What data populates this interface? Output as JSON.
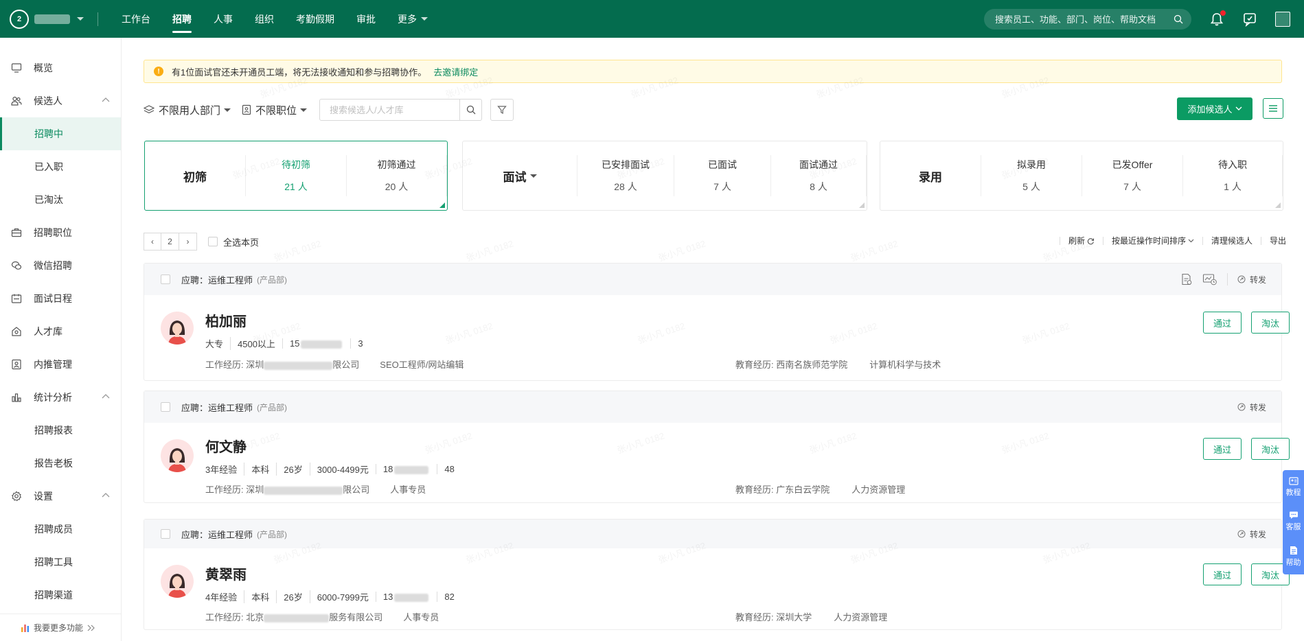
{
  "topbar": {
    "logo_text": "2",
    "nav": [
      "工作台",
      "招聘",
      "人事",
      "组织",
      "考勤假期",
      "审批",
      "更多"
    ],
    "active_nav": 1,
    "search_placeholder": "搜索员工、功能、部门、岗位、帮助文档"
  },
  "sidebar": {
    "items": [
      {
        "label": "概览",
        "icon": "monitor-icon"
      },
      {
        "label": "候选人",
        "icon": "people-icon"
      },
      {
        "label": "招聘中"
      },
      {
        "label": "已入职"
      },
      {
        "label": "已淘汰"
      },
      {
        "label": "招聘职位",
        "icon": "briefcase-icon"
      },
      {
        "label": "微信招聘",
        "icon": "wechat-icon"
      },
      {
        "label": "面试日程",
        "icon": "calendar-icon"
      },
      {
        "label": "人才库",
        "icon": "talent-icon"
      },
      {
        "label": "内推管理",
        "icon": "referral-icon"
      },
      {
        "label": "统计分析",
        "icon": "chart-icon"
      },
      {
        "label": "招聘报表"
      },
      {
        "label": "报告老板"
      },
      {
        "label": "设置",
        "icon": "gear-icon"
      },
      {
        "label": "招聘成员"
      },
      {
        "label": "招聘工具"
      },
      {
        "label": "招聘渠道"
      }
    ],
    "footer": "我要更多功能"
  },
  "notice": {
    "text": "有1位面试官还未开通员工端，将无法接收通知和参与招聘协作。",
    "link": "去邀请绑定"
  },
  "filters": {
    "dept": "不限用人部门",
    "position": "不限职位",
    "search_placeholder": "搜索候选人/人才库",
    "add_label": "添加候选人"
  },
  "stages": {
    "screen": {
      "title": "初筛",
      "cells": [
        {
          "label": "待初筛",
          "count": "21 人"
        },
        {
          "label": "初筛通过",
          "count": "20 人"
        }
      ]
    },
    "interview": {
      "title": "面试",
      "cells": [
        {
          "label": "已安排面试",
          "count": "28 人"
        },
        {
          "label": "已面试",
          "count": "7 人"
        },
        {
          "label": "面试通过",
          "count": "8 人"
        }
      ]
    },
    "hire": {
      "title": "录用",
      "cells": [
        {
          "label": "拟录用",
          "count": "5 人"
        },
        {
          "label": "已发Offer",
          "count": "7 人"
        },
        {
          "label": "待入职",
          "count": "1 人"
        }
      ]
    }
  },
  "pager": {
    "prev": "‹",
    "page": "2",
    "next": "›",
    "select_all": "全选本页"
  },
  "toolbar": {
    "refresh": "刷新",
    "sort": "按最近操作时间排序",
    "clean": "清理候选人",
    "export": "导出"
  },
  "candidate_labels": {
    "apply_prefix": "应聘：",
    "forward": "转发",
    "pass": "通过",
    "reject": "淘汰",
    "work_prefix": "工作经历:",
    "edu_prefix": "教育经历:"
  },
  "candidates": [
    {
      "position": "运维工程师",
      "dept": "(产品部)",
      "name": "柏加丽",
      "info": [
        "大专",
        "4500以上",
        "15"
      ],
      "phone_tail": "3",
      "work_company_start": "深圳",
      "work_company_end": "限公司",
      "work_role": "SEO工程师/网站编辑",
      "edu_school": "西南名族师范学院",
      "edu_major": "计算机科学与技术"
    },
    {
      "position": "运维工程师",
      "dept": "(产品部)",
      "name": "何文静",
      "info": [
        "3年经验",
        "本科",
        "26岁",
        "3000-4499元",
        "18"
      ],
      "phone_tail": "48",
      "work_company_start": "深圳",
      "work_company_end": "限公司",
      "work_role": "人事专员",
      "edu_school": "广东白云学院",
      "edu_major": "人力资源管理"
    },
    {
      "position": "运维工程师",
      "dept": "(产品部)",
      "name": "黄翠雨",
      "info": [
        "4年经验",
        "本科",
        "26岁",
        "6000-7999元",
        "13"
      ],
      "phone_tail": "82",
      "work_company_start": "北京",
      "work_company_end": "服务有限公司",
      "work_role": "人事专员",
      "edu_school": "深圳大学",
      "edu_major": "人力资源管理"
    }
  ],
  "float_help": [
    "教程",
    "客服",
    "帮助"
  ],
  "watermark": "张小凡 0182"
}
